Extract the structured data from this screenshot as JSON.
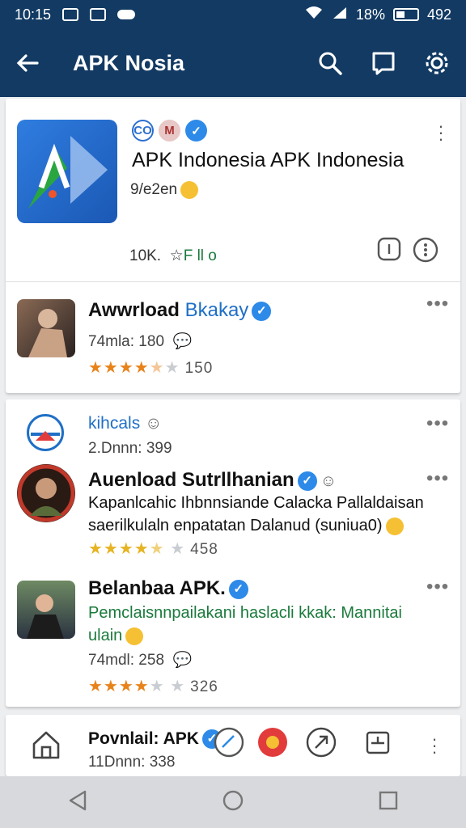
{
  "status": {
    "time": "10:15",
    "battery": "18%",
    "clock_right": "492"
  },
  "appbar": {
    "title": "APK Nosia"
  },
  "featured": {
    "title": "APK Indonesia APK Indonesia",
    "subtitle": "9/e2en",
    "stat_count": "10K.",
    "stat_label": "F ll o"
  },
  "item1": {
    "name": "Awwrload",
    "name_accent": "Bkakay",
    "meta": "74mla: 180",
    "rating_count": "150",
    "rating": 3.5
  },
  "section2": {
    "name": "kihcals",
    "meta": "2.Dnnn: 399"
  },
  "item2": {
    "name": "Auenload Sutrllhanian",
    "desc": "Kapanlcahic Ihbnnsiande Calacka Pallaldaisan saerilkulaln enpatatan Dalanud (suniua0)",
    "rating_count": "458",
    "rating": 4.5
  },
  "item3": {
    "name": "Belanbaa APK.",
    "desc": "Pemclaisnnpailakani haslacli kkak: Mannitai ulain",
    "meta": "74mdl: 258",
    "rating_count": "326",
    "rating": 4
  },
  "item4": {
    "name": "Povnlail: APK",
    "meta": "11Dnnn: 338"
  },
  "colors": {
    "primary": "#123a63",
    "accent": "#2d8ae8",
    "star": "#e8831a",
    "green": "#1a7a3c"
  }
}
